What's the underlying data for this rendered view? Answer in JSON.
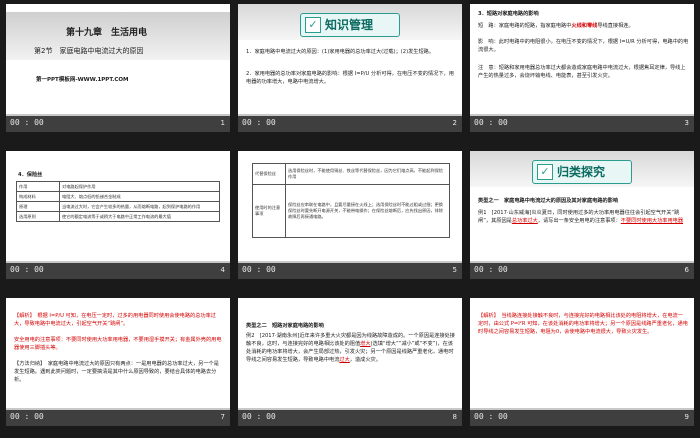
{
  "slides": [
    {
      "time": "00 : 00",
      "number": "1",
      "chapter": "第十九章　生活用电",
      "section": "第2节　家庭电路中电流过大的原因",
      "site": "第一PPT模板网-WWW.1PPT.COM"
    },
    {
      "time": "00 : 00",
      "number": "2",
      "heading": "知识管理",
      "p1": "1．家庭电路中电流过大的原因：(1)家用电器的总功率过大(过载)；(2)发生短路。",
      "p2": "2．家用电器的总功率对家庭电路的影响：根据 I=P/U 分析可得，在电压不变的情况下，用电器的功率增大，电路中电流增大。"
    },
    {
      "time": "00 : 00",
      "number": "3",
      "p1": "3．短路对家庭电路的影响",
      "p2": "短　路：家庭电路的短路，指家庭电路中",
      "p2red": "火线和零线",
      "p2b": "导线直接相连。",
      "p3": "影　响：此时电路中的电阻很小，在电压不变的情况下，根据 I=U/R 分析可得，电路中的电流很大。",
      "p4": "注　意：短路和家用电器总功率过大都会造成家庭电路中电流过大，根据焦耳定律，导线上产生的热量过多，会烧坏输电线、电能表，甚至引发火灾。"
    },
    {
      "time": "00 : 00",
      "number": "4",
      "title": "4．保险丝",
      "rows": [
        [
          "作用",
          "对电路起保护作用"
        ],
        [
          "构成材料",
          "电阻大、熔点低的铅锑合金制成"
        ],
        [
          "原理",
          "当电流过大时，它会产生较多的热量，从而熔断电路，起到保护电路的作用"
        ],
        [
          "选用原则",
          "使它的额定电流等于或稍大于电路中正常工作电流的最大值"
        ]
      ]
    },
    {
      "time": "00 : 00",
      "number": "5",
      "rows": [
        [
          "代替保险丝",
          "选用保险丝时，不能使用铜丝、铁丝等代替保险丝，因为它们熔点高，不能起到保险作用"
        ],
        [
          "使用时的注意事项",
          "保险丝应串联在电路中，且要尽量接在火线上；选用保险丝时不能过粗或过细；更换保险丝时要先断开电源开关，不能带电操作；在保险丝熔断后，应先找出原因，排除故障后再接通电路。"
        ]
      ]
    },
    {
      "time": "00 : 00",
      "number": "6",
      "heading": "归类探究",
      "type1": "类型之一　家庭电路中电流过大的原因及其对家庭电路的影响",
      "ex": "例1　[2017·山东威海]炎炎夏日，同时使用过多的大功率用电器往往会引起空气开关“跳闸”，其原因是",
      "ans": "总功率过大",
      "ex2": "，请写出一条安全用电的注意事项：",
      "ans2": "不要同时使用大功率用电器"
    },
    {
      "time": "00 : 00",
      "number": "7",
      "p1": "【解析】　根据 I=P/U 可知，在电压一定时，过多的用电器同时使用会使电路的总功率过大，导致电路中电流过大，引起空气开关“跳闸”。",
      "p2": "安全用电的注意事项：不要同时使用大功率用电器，不要用湿手摸开关；有金属外壳的用电器使用三脚插头等。",
      "p3": "【方法归纳】　家庭电路中电流过大的原因只有两点：一是用电器的总功率过大，另一个是发生短路。遇到此类问题时，一定要搞清是其中什么原因导致的，要结合具体的电路去分析。"
    },
    {
      "time": "00 : 00",
      "number": "8",
      "type2": "类型之二　短路对家庭电路的影响",
      "p1": "例2　[2017·湖南永州]近年来许多重大火灾都是因为线路故障造成的。一个原因是连接处接触不良，这时，与连接完好的电路相比该处的阻值",
      "ans": "增大",
      "p1b": "(选填“增大”“减小”或“不变”)，在该处消耗的电功率将增大，会产生局部过热，引发火灾；另一个原因是线路严重老化，通电时导线之间容易发生短路，导致电路中电流",
      "ans2": "过大",
      "p1c": "，造成火灾。"
    },
    {
      "time": "00 : 00",
      "number": "9",
      "p1": "【解析】　当线路连接处接触不良时，与连接完好的电路相比该处的电阻将增大，在电流一定时，由公式 P=I²R 可知，在该处消耗的电功率将增大；另一个原因是线路严重老化，通电时导线之间容易发生短路，电阻为0，会使电路中电流很大，导致火灾发生。"
    }
  ]
}
